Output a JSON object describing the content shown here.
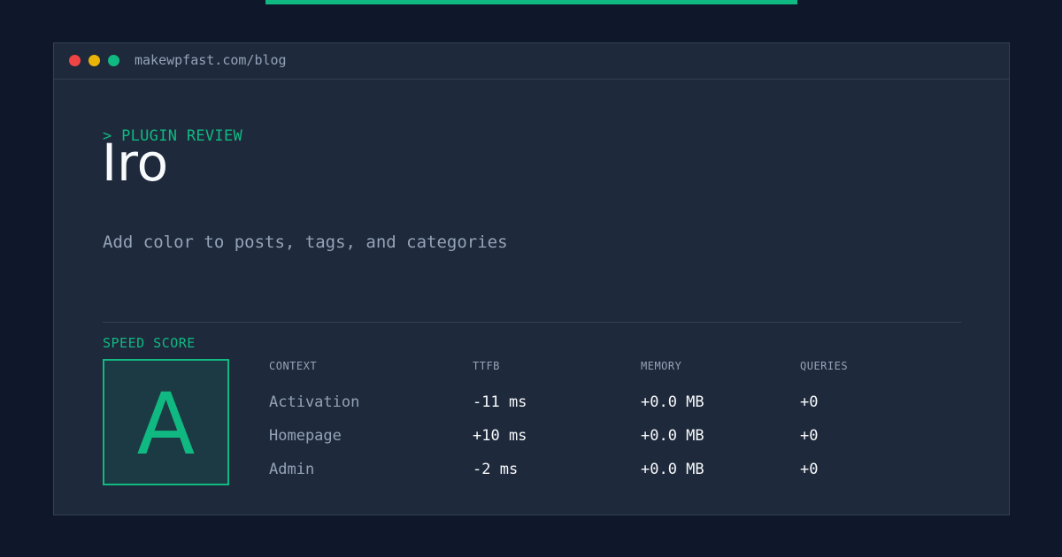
{
  "colors": {
    "page_background": "#0f172a",
    "window_background": "#1e293b",
    "accent": "#10b981",
    "text_primary": "#f8fafc",
    "text_muted": "#94a3b8",
    "dot_red": "#ef4444",
    "dot_yellow": "#eab308",
    "dot_green": "#10b981"
  },
  "window": {
    "url": "makewpfast.com/blog"
  },
  "hero": {
    "kicker": "> PLUGIN REVIEW",
    "title": "Iro",
    "subtitle": "Add color to posts, tags, and categories"
  },
  "score": {
    "label": "SPEED SCORE",
    "grade": "A"
  },
  "metrics": {
    "headers": [
      "CONTEXT",
      "TTFB",
      "MEMORY",
      "QUERIES"
    ],
    "rows": [
      [
        "Activation",
        "-11 ms",
        "+0.0 MB",
        "+0"
      ],
      [
        "Homepage",
        "+10 ms",
        "+0.0 MB",
        "+0"
      ],
      [
        "Admin",
        "-2 ms",
        "+0.0 MB",
        "+0"
      ]
    ]
  }
}
